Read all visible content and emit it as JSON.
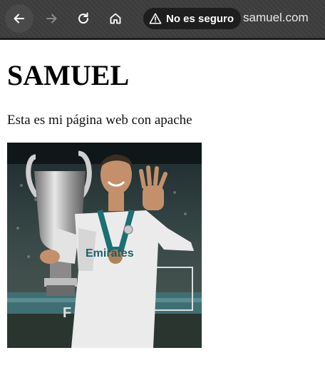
{
  "browser": {
    "buttons": {
      "back": "back-arrow-icon",
      "forward": "forward-arrow-icon",
      "reload": "reload-icon",
      "home": "home-icon"
    },
    "security": {
      "icon": "warning-icon",
      "label": "No es seguro"
    },
    "url": "samuel.com",
    "colors": {
      "toolbar": "#3c3c3c",
      "chip": "#1e1e1e"
    }
  },
  "page": {
    "title": "SAMUEL",
    "text": "Esta es mi página web con apache",
    "image": {
      "jersey_text": "Emirates",
      "sleeve_text": "F"
    }
  }
}
